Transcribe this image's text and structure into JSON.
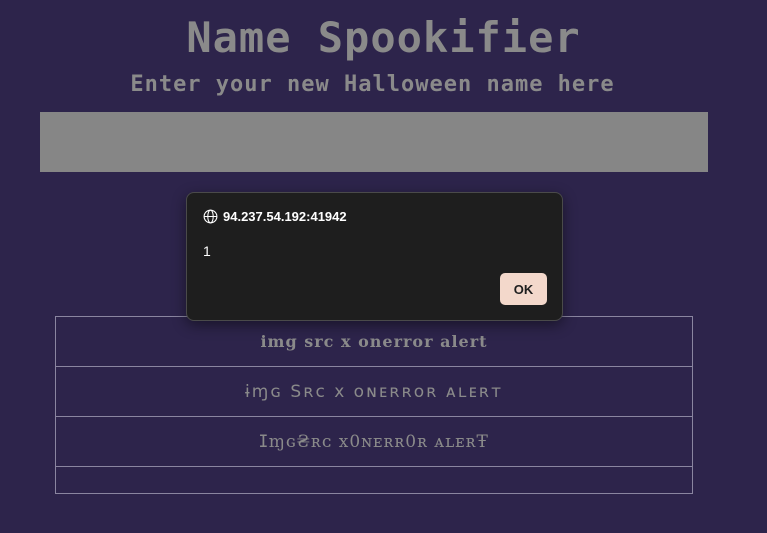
{
  "page": {
    "title": "Name Spookifier",
    "subtitle": "Enter your new Halloween name here"
  },
  "name_input": {
    "value": "",
    "placeholder": ""
  },
  "results": [
    "img  src  x  onerror  alert",
    "ɨɱɢ  Sʀᴄ  x  ᴏɴᴇʀʀᴏʀ  ᴀʟᴇʀᴛ",
    "ⵊɱɢ₴ʀᴄ  x0ɴᴇʀʀ0ʀ  ᴀʟᴇʀŦ",
    ""
  ],
  "alert_dialog": {
    "origin": "94.237.54.192:41942",
    "message": "1",
    "ok_label": "OK",
    "icon": "globe-icon"
  },
  "colors": {
    "background": "#2d244b",
    "text": "#8a8a8a",
    "input_background": "#868686",
    "table_border": "#8a85a0",
    "dialog_background": "#1e1e1e",
    "ok_button": "#f3d8cb"
  }
}
